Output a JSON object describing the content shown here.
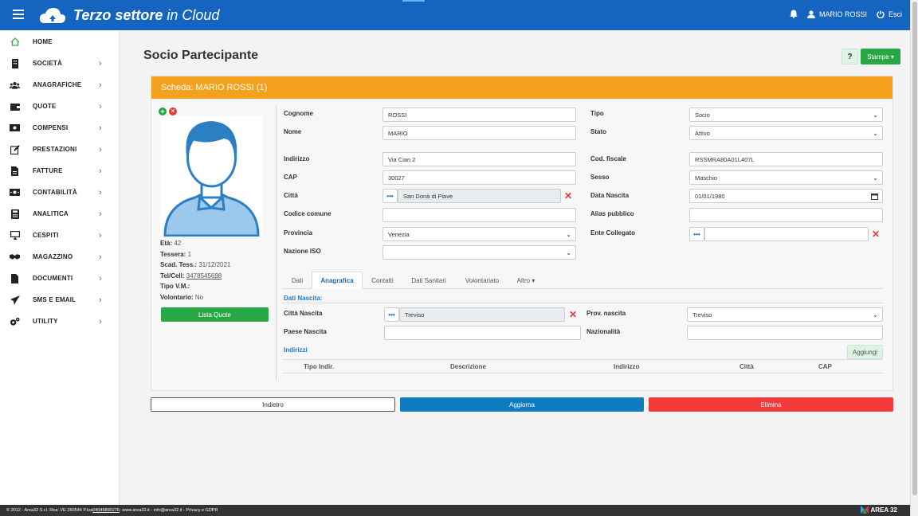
{
  "app": {
    "brand_bold": "Terzo settore",
    "brand_light": " in Cloud"
  },
  "header": {
    "user_name": "MARIO ROSSI",
    "logout_label": "Esci"
  },
  "sidebar": {
    "items": [
      {
        "label": "HOME",
        "icon": "home-icon"
      },
      {
        "label": "SOCIETÀ",
        "icon": "building-icon"
      },
      {
        "label": "ANAGRAFICHE",
        "icon": "users-icon"
      },
      {
        "label": "QUOTE",
        "icon": "wallet-icon"
      },
      {
        "label": "COMPENSI",
        "icon": "money-icon"
      },
      {
        "label": "PRESTAZIONI",
        "icon": "edit-icon"
      },
      {
        "label": "FATTURE",
        "icon": "invoice-icon"
      },
      {
        "label": "CONTABILITÀ",
        "icon": "cash-icon"
      },
      {
        "label": "ANALITICA",
        "icon": "calculator-icon"
      },
      {
        "label": "CESPITI",
        "icon": "monitor-icon"
      },
      {
        "label": "MAGAZZINO",
        "icon": "handshake-icon"
      },
      {
        "label": "DOCUMENTI",
        "icon": "document-icon"
      },
      {
        "label": "SMS E EMAIL",
        "icon": "send-icon"
      },
      {
        "label": "UTILITY",
        "icon": "cogs-icon"
      }
    ]
  },
  "page": {
    "title": "Socio Partecipante",
    "help_label": "?",
    "stampe_label": "Stampe",
    "card_header": "Scheda: MARIO ROSSI (1)"
  },
  "profile": {
    "eta_label": "Età:",
    "eta_value": "42",
    "tessera_label": "Tessera:",
    "tessera_value": "1",
    "scad_label": "Scad. Tess.:",
    "scad_value": "31/12/2021",
    "tel_label": "Tel/Cell:",
    "tel_value": "3478545698",
    "tipovm_label": "Tipo V.M.:",
    "tipovm_value": "",
    "vol_label": "Volontario:",
    "vol_value": "No",
    "lista_quote_label": "Lista Quote"
  },
  "form": {
    "cognome_label": "Cognome",
    "cognome_value": "ROSSI",
    "nome_label": "Nome",
    "nome_value": "MARIO",
    "tipo_label": "Tipo",
    "tipo_value": "Socio",
    "stato_label": "Stato",
    "stato_value": "Attivo",
    "indirizzo_label": "Indirizzo",
    "indirizzo_value": "Via Cian 2",
    "cap_label": "CAP",
    "cap_value": "30027",
    "citta_label": "Città",
    "citta_value": "San Donà di Piave",
    "codcom_label": "Codice comune",
    "codcom_value": "",
    "provincia_label": "Provincia",
    "provincia_value": "Venezia",
    "nazione_label": "Nazione ISO",
    "nazione_value": "",
    "codfis_label": "Cod. fiscale",
    "codfis_value": "RSSMRA80A01L407L",
    "sesso_label": "Sesso",
    "sesso_value": "Maschio",
    "datanasc_label": "Data Nascita",
    "datanasc_value": "01/01/1980",
    "alias_label": "Alias pubblico",
    "alias_value": "",
    "ente_label": "Ente Collegato",
    "ente_value": ""
  },
  "tabs": [
    "Dati",
    "Anagrafica",
    "Contatti",
    "Dati Sanitari",
    "Volontariato",
    "Altro ▾"
  ],
  "anagrafica": {
    "dati_nascita_title": "Dati Nascita:",
    "citta_nascita_label": "Città Nascita",
    "citta_nascita_value": "Treviso",
    "paese_nascita_label": "Paese Nascita",
    "paese_nascita_value": "",
    "prov_nascita_label": "Prov. nascita",
    "prov_nascita_value": "Treviso",
    "nazionalita_label": "Nazionalità",
    "nazionalita_value": "",
    "indirizzi_title": "Indirizzi",
    "aggiungi_label": "Aggiungi",
    "columns": [
      "Tipo Indir.",
      "Descrizione",
      "Indirizzo",
      "Città",
      "CAP"
    ]
  },
  "actions": {
    "indietro": "Indietro",
    "aggiorna": "Aggiorna",
    "elimina": "Elimina"
  },
  "footer": {
    "text_pre": "© 2012 - Area32 S.r.l. Rea: VE-360544 P.Iva ",
    "piva": "04045890276",
    "text_post": " - www.area32.it - info@area32.it - Privacy e GDPR",
    "brand": "AREA 32"
  },
  "colors": {
    "primary": "#1565c0",
    "orange": "#f4a21e",
    "green": "#28a745",
    "red": "#f23a3a",
    "blue_btn": "#0f7bc0"
  }
}
